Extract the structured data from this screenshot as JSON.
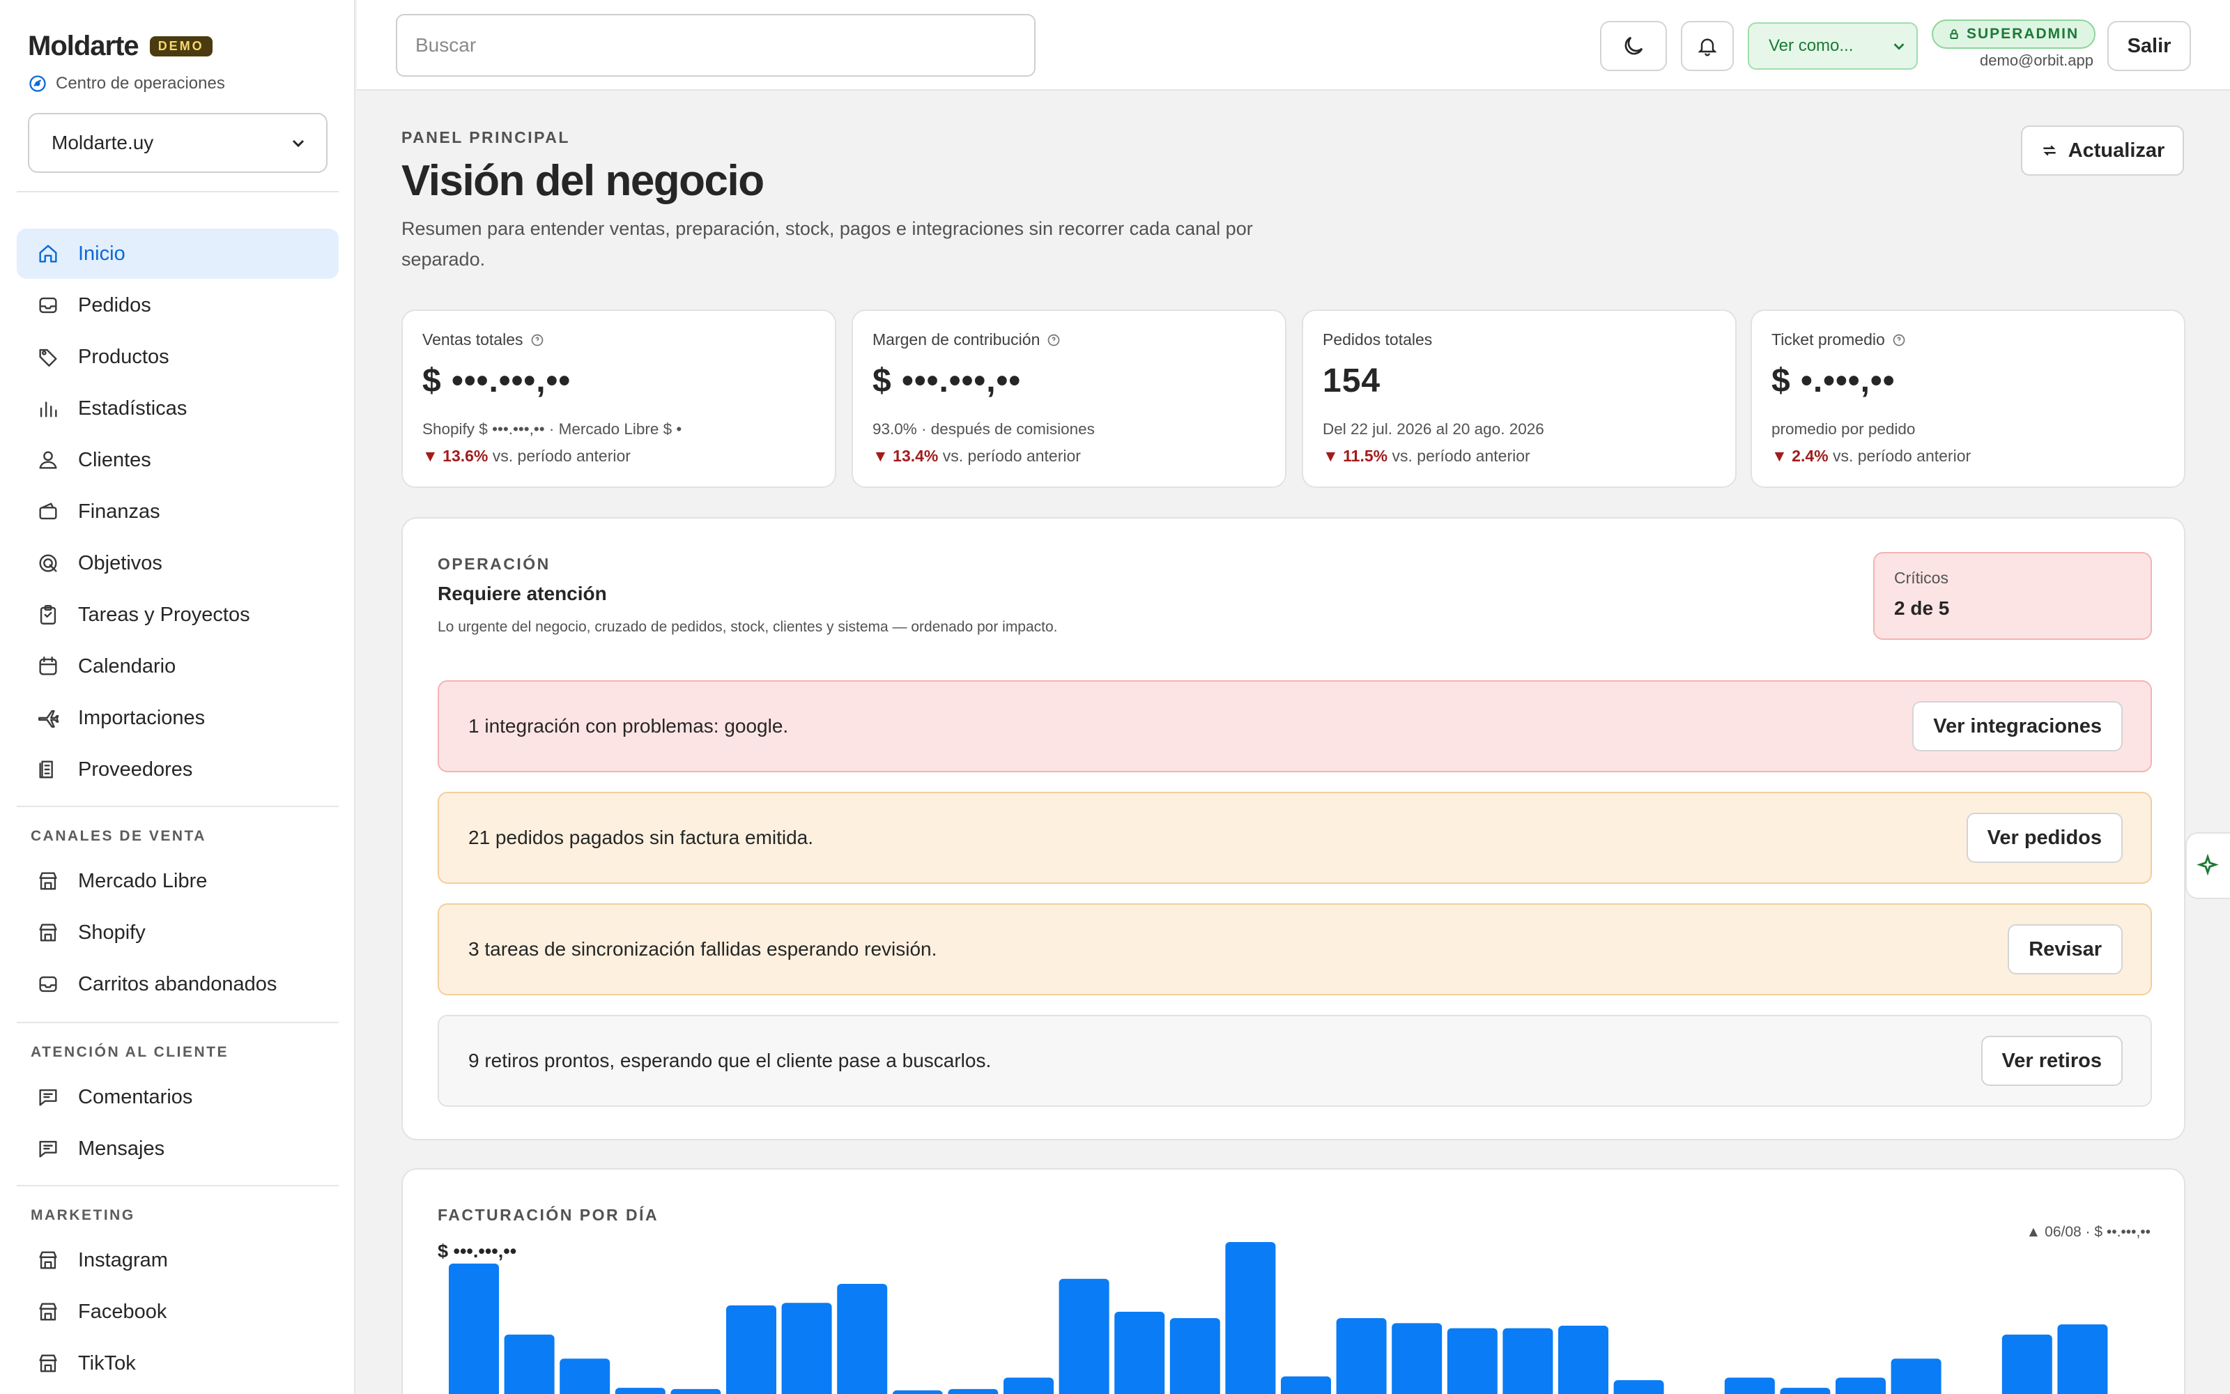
{
  "brand": {
    "name": "Moldarte",
    "badge": "DEMO",
    "subtitle": "Centro de operaciones",
    "store_selected": "Moldarte.uy"
  },
  "nav": {
    "main": [
      {
        "label": "Inicio",
        "icon": "home-icon"
      },
      {
        "label": "Pedidos",
        "icon": "inbox-icon"
      },
      {
        "label": "Productos",
        "icon": "tag-icon"
      },
      {
        "label": "Estadísticas",
        "icon": "bar-chart-icon"
      },
      {
        "label": "Clientes",
        "icon": "user-icon"
      },
      {
        "label": "Finanzas",
        "icon": "wallet-icon"
      },
      {
        "label": "Objetivos",
        "icon": "target-icon"
      },
      {
        "label": "Tareas y Proyectos",
        "icon": "clipboard-icon"
      },
      {
        "label": "Calendario",
        "icon": "calendar-icon"
      },
      {
        "label": "Importaciones",
        "icon": "plane-icon"
      },
      {
        "label": "Proveedores",
        "icon": "supplier-icon"
      }
    ],
    "sales_title": "CANALES DE VENTA",
    "sales": [
      {
        "label": "Mercado Libre",
        "icon": "store-icon"
      },
      {
        "label": "Shopify",
        "icon": "store-icon"
      },
      {
        "label": "Carritos abandonados",
        "icon": "inbox-icon"
      }
    ],
    "support_title": "ATENCIÓN AL CLIENTE",
    "support": [
      {
        "label": "Comentarios",
        "icon": "chat-icon"
      },
      {
        "label": "Mensajes",
        "icon": "chat-icon"
      }
    ],
    "marketing_title": "MARKETING",
    "marketing": [
      {
        "label": "Instagram",
        "icon": "store-icon"
      },
      {
        "label": "Facebook",
        "icon": "store-icon"
      },
      {
        "label": "TikTok",
        "icon": "store-icon"
      }
    ]
  },
  "header": {
    "search_placeholder": "Buscar",
    "view_as": "Ver como...",
    "role": "SUPERADMIN",
    "email": "demo@orbit.app",
    "logout": "Salir"
  },
  "page": {
    "eyebrow": "PANEL PRINCIPAL",
    "title": "Visión del negocio",
    "description": "Resumen para entender ventas, preparación, stock, pagos e integraciones sin recorrer cada canal por separado.",
    "refresh": "Actualizar"
  },
  "kpis": [
    {
      "label": "Ventas totales",
      "value": "$ •••.•••,••",
      "sub": "Shopify $ •••.•••,•• · Mercado Libre $ •",
      "delta": "13.6%",
      "delta_text": "vs. período anterior",
      "info": true
    },
    {
      "label": "Margen de contribución",
      "value": "$ •••.•••,••",
      "sub": "93.0% · después de comisiones",
      "delta": "13.4%",
      "delta_text": "vs. período anterior",
      "info": true
    },
    {
      "label": "Pedidos totales",
      "value": "154",
      "sub": "Del 22 jul. 2026 al 20 ago. 2026",
      "delta": "11.5%",
      "delta_text": "vs. período anterior",
      "info": false
    },
    {
      "label": "Ticket promedio",
      "value": "$ •.•••,••",
      "sub": "promedio por pedido",
      "delta": "2.4%",
      "delta_text": "vs. período anterior",
      "info": true
    }
  ],
  "operation": {
    "eyebrow": "OPERACIÓN",
    "title": "Requiere atención",
    "description": "Lo urgente del negocio, cruzado de pedidos, stock, clientes y sistema — ordenado por impacto.",
    "critical_label": "Críticos",
    "critical_value": "2 de 5",
    "alerts": [
      {
        "text": "1 integración con problemas: google.",
        "button": "Ver integraciones",
        "level": "red"
      },
      {
        "text": "21 pedidos pagados sin factura emitida.",
        "button": "Ver pedidos",
        "level": "orange"
      },
      {
        "text": "3 tareas de sincronización fallidas esperando revisión.",
        "button": "Revisar",
        "level": "orange"
      },
      {
        "text": "9 retiros prontos, esperando que el cliente pase a buscarlos.",
        "button": "Ver retiros",
        "level": "gray"
      }
    ]
  },
  "chart_data": {
    "type": "bar",
    "title": "FACTURACIÓN POR DÍA",
    "total": "$ •••.•••,••",
    "peak": "▲ 06/08 · $ ••.•••,••",
    "values": [
      104,
      48,
      29,
      6,
      5,
      71,
      73,
      88,
      4,
      5,
      14,
      92,
      66,
      61,
      121,
      15,
      61,
      57,
      53,
      53,
      55,
      12,
      0,
      14,
      6,
      14,
      29,
      0,
      48,
      56
    ],
    "color": "#0a7cf5"
  },
  "colors": {
    "accent": "#0b69d6",
    "bar": "#0a7cf5",
    "danger": "#a11c1c",
    "success": "#1c7a35"
  }
}
